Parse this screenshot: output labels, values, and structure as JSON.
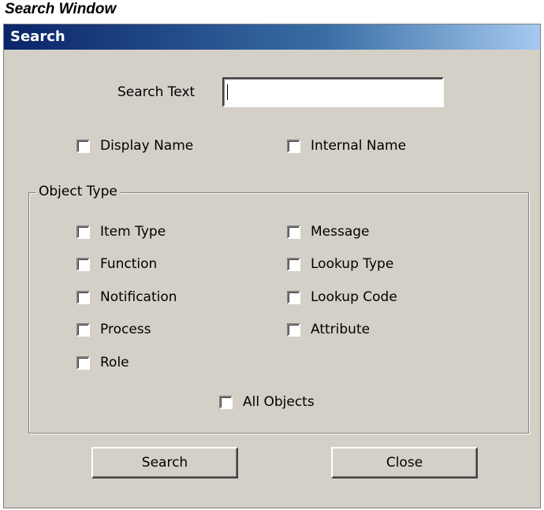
{
  "caption": "Search Window",
  "window": {
    "title": "Search"
  },
  "search": {
    "label": "Search Text",
    "value": ""
  },
  "name_options": {
    "display_name": "Display Name",
    "internal_name": "Internal Name"
  },
  "object_type": {
    "legend": "Object Type",
    "left": [
      "Item Type",
      "Function",
      "Notification",
      "Process",
      "Role"
    ],
    "right": [
      "Message",
      "Lookup Type",
      "Lookup Code",
      "Attribute"
    ],
    "all_objects": "All Objects"
  },
  "buttons": {
    "search": "Search",
    "close": "Close"
  }
}
